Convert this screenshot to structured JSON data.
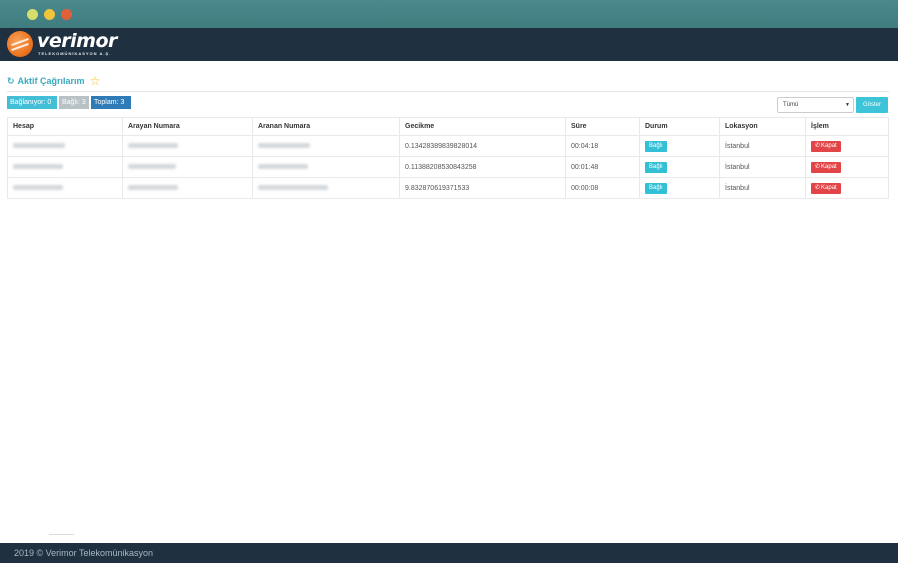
{
  "brand": {
    "name": "verimor",
    "subtitle": "TELEKOMÜNİKASYON A.Ş."
  },
  "page": {
    "title": "Aktif Çağrılarım"
  },
  "badges": {
    "connecting": "Bağlanıyor: 0",
    "connected": "Bağlı: 3",
    "total": "Toplam: 3"
  },
  "filter": {
    "selected": "Tümü",
    "button": "Göster"
  },
  "table": {
    "headers": [
      "Hesap",
      "Arayan Numara",
      "Aranan Numara",
      "Gecikme",
      "Süre",
      "Durum",
      "Lokasyon",
      "İşlem"
    ],
    "rows": [
      {
        "delay": "0.13428389839828014",
        "duration": "00:04:18",
        "status": "Bağlı",
        "location": "İstanbul",
        "action": "Kapat"
      },
      {
        "delay": "0.11388208530843258",
        "duration": "00:01:48",
        "status": "Bağlı",
        "location": "İstanbul",
        "action": "Kapat"
      },
      {
        "delay": "9.832870619371533",
        "duration": "00:00:08",
        "status": "Bağlı",
        "location": "İstanbul",
        "action": "Kapat"
      }
    ]
  },
  "footer": {
    "text": "2019 © Verimor Telekomünikasyon"
  },
  "colors": {
    "header_bg": "#1f3040",
    "accent": "#3ec4d8",
    "danger": "#e24548",
    "title": "#3aa9bd"
  }
}
